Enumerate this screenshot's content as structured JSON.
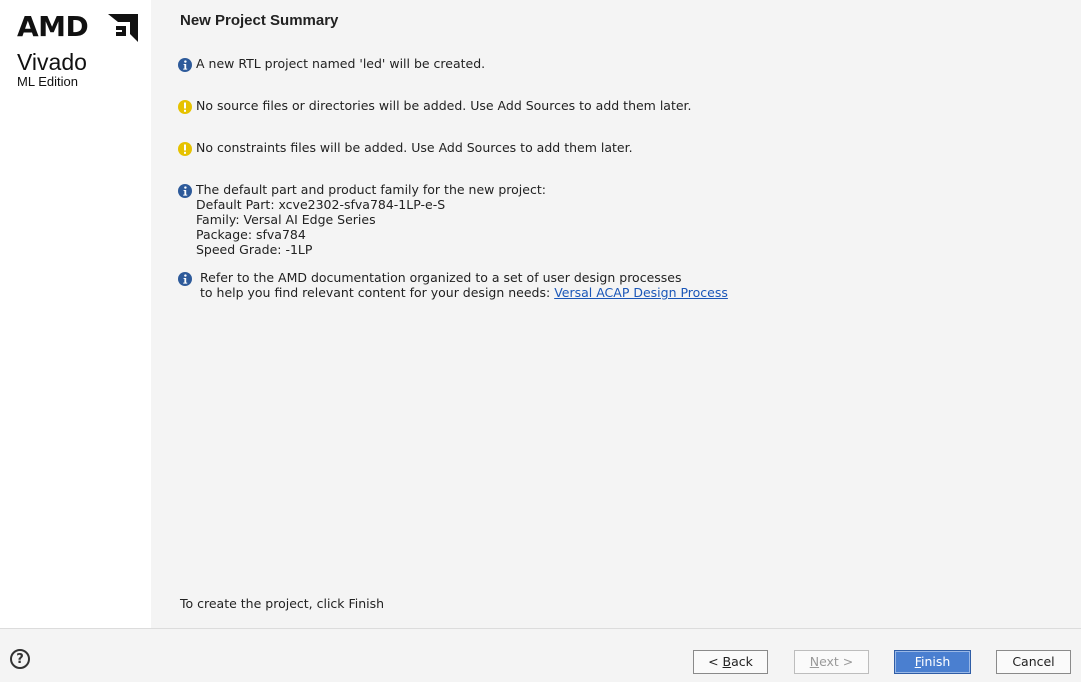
{
  "brand": {
    "company": "AMD",
    "product": "Vivado",
    "edition": "ML Edition"
  },
  "page": {
    "title": "New Project Summary"
  },
  "messages": [
    {
      "type": "info",
      "icon": "info-icon",
      "text": "A new RTL project named 'led' will be created."
    },
    {
      "type": "warning",
      "icon": "warning-icon",
      "text": "No source files or directories will be added. Use Add Sources to add them later."
    },
    {
      "type": "warning",
      "icon": "warning-icon",
      "text": "No constraints files will be added. Use Add Sources to add them later."
    }
  ],
  "part_info": {
    "icon": "info-icon",
    "heading": "The default part and product family for the new project:",
    "default_part": "Default Part: xcve2302-sfva784-1LP-e-S",
    "family": "Family: Versal AI Edge Series",
    "package": "Package: sfva784",
    "speed_grade": "Speed Grade: -1LP"
  },
  "reference": {
    "icon": "info-icon",
    "line1": "Refer to the AMD documentation organized to a set of user design processes",
    "line2_prefix": "to help you find relevant content for your design needs: ",
    "link_text": "Versal ACAP Design Process"
  },
  "footer_note": "To create the project, click Finish",
  "buttons": {
    "help": "?",
    "back_mnemonic": "B",
    "back_rest": "ack",
    "back_prefix": "< ",
    "next_mnemonic": "N",
    "next_rest": "ext >",
    "next_enabled": false,
    "finish_mnemonic": "F",
    "finish_rest": "inish",
    "cancel": "Cancel"
  },
  "colors": {
    "accent": "#4a7fd0",
    "info": "#2d5a9a",
    "warning": "#e6c200",
    "link": "#1a56b8"
  }
}
